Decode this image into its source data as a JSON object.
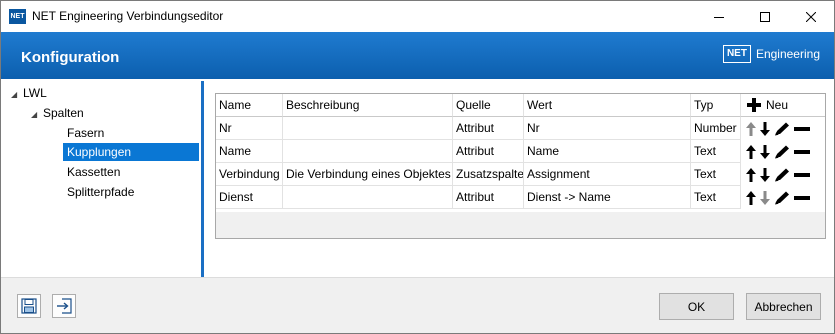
{
  "window": {
    "app_icon_text": "NET",
    "title": "NET Engineering Verbindungseditor"
  },
  "header": {
    "title": "Konfiguration",
    "brand_box": "NET",
    "brand_text": "Engineering"
  },
  "tree": {
    "root": "LWL",
    "group": "Spalten",
    "items": [
      {
        "label": "Fasern"
      },
      {
        "label": "Kupplungen",
        "selected": true
      },
      {
        "label": "Kassetten"
      },
      {
        "label": "Splitterpfade"
      }
    ]
  },
  "grid": {
    "columns": [
      "Name",
      "Beschreibung",
      "Quelle",
      "Wert",
      "Typ"
    ],
    "new_label": "Neu",
    "rows": [
      {
        "name": "Nr",
        "beschreibung": "",
        "quelle": "Attribut",
        "wert": "Nr",
        "typ": "Number",
        "up_enabled": false,
        "down_enabled": true
      },
      {
        "name": "Name",
        "beschreibung": "",
        "quelle": "Attribut",
        "wert": "Name",
        "typ": "Text",
        "up_enabled": true,
        "down_enabled": true
      },
      {
        "name": "Verbindung",
        "beschreibung": "Die Verbindung eines Objektes",
        "quelle": "Zusatzspalte",
        "wert": "Assignment",
        "typ": "Text",
        "up_enabled": true,
        "down_enabled": true
      },
      {
        "name": "Dienst",
        "beschreibung": "",
        "quelle": "Attribut",
        "wert": "Dienst -> Name",
        "typ": "Text",
        "up_enabled": true,
        "down_enabled": false
      }
    ]
  },
  "footer": {
    "ok_label": "OK",
    "cancel_label": "Abbrechen"
  },
  "colors": {
    "header_blue": "#0c5fae",
    "selection_blue": "#0a77d4",
    "disabled_arrow": "#8a8a8a"
  },
  "icons": [
    "save-icon",
    "export-icon",
    "plus-icon",
    "arrow-up-icon",
    "arrow-down-icon",
    "pencil-icon",
    "minus-icon",
    "minimize-icon",
    "maximize-icon",
    "close-icon"
  ]
}
